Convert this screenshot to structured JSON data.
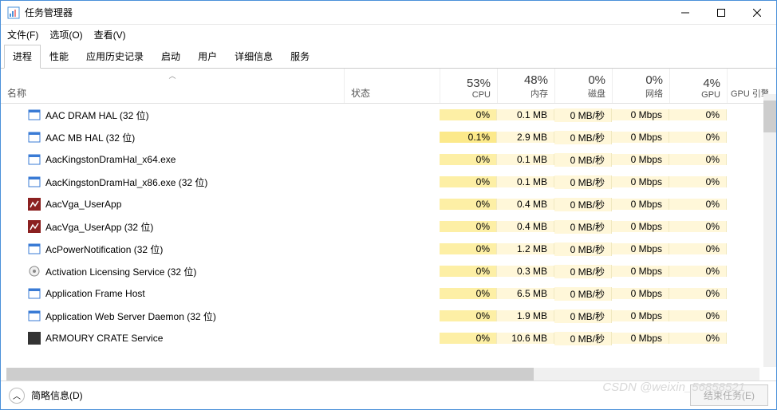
{
  "window": {
    "title": "任务管理器",
    "menus": {
      "file": "文件(F)",
      "options": "选项(O)",
      "view": "查看(V)"
    },
    "tabs": [
      "进程",
      "性能",
      "应用历史记录",
      "启动",
      "用户",
      "详细信息",
      "服务"
    ],
    "active_tab": 0
  },
  "columns": {
    "name": "名称",
    "status": "状态",
    "cpu": {
      "pct": "53%",
      "label": "CPU"
    },
    "memory": {
      "pct": "48%",
      "label": "内存"
    },
    "disk": {
      "pct": "0%",
      "label": "磁盘"
    },
    "network": {
      "pct": "0%",
      "label": "网络"
    },
    "gpu": {
      "pct": "4%",
      "label": "GPU"
    },
    "gpu_engine": "GPU 引擎"
  },
  "processes": [
    {
      "icon": "app-blue",
      "name": "AAC DRAM HAL (32 位)",
      "cpu": "0%",
      "mem": "0.1 MB",
      "disk": "0 MB/秒",
      "net": "0 Mbps",
      "gpu": "0%",
      "cpu_hl": "hl05"
    },
    {
      "icon": "app-blue",
      "name": "AAC MB HAL (32 位)",
      "cpu": "0.1%",
      "mem": "2.9 MB",
      "disk": "0 MB/秒",
      "net": "0 Mbps",
      "gpu": "0%",
      "cpu_hl": "hl1"
    },
    {
      "icon": "app-blue",
      "name": "AacKingstonDramHal_x64.exe",
      "cpu": "0%",
      "mem": "0.1 MB",
      "disk": "0 MB/秒",
      "net": "0 Mbps",
      "gpu": "0%",
      "cpu_hl": "hl05"
    },
    {
      "icon": "app-blue",
      "name": "AacKingstonDramHal_x86.exe (32 位)",
      "cpu": "0%",
      "mem": "0.1 MB",
      "disk": "0 MB/秒",
      "net": "0 Mbps",
      "gpu": "0%",
      "cpu_hl": "hl05"
    },
    {
      "icon": "app-red",
      "name": "AacVga_UserApp",
      "cpu": "0%",
      "mem": "0.4 MB",
      "disk": "0 MB/秒",
      "net": "0 Mbps",
      "gpu": "0%",
      "cpu_hl": "hl05"
    },
    {
      "icon": "app-red",
      "name": "AacVga_UserApp (32 位)",
      "cpu": "0%",
      "mem": "0.4 MB",
      "disk": "0 MB/秒",
      "net": "0 Mbps",
      "gpu": "0%",
      "cpu_hl": "hl05"
    },
    {
      "icon": "app-blue",
      "name": "AcPowerNotification (32 位)",
      "cpu": "0%",
      "mem": "1.2 MB",
      "disk": "0 MB/秒",
      "net": "0 Mbps",
      "gpu": "0%",
      "cpu_hl": "hl05"
    },
    {
      "icon": "app-gear",
      "name": "Activation Licensing Service (32 位)",
      "cpu": "0%",
      "mem": "0.3 MB",
      "disk": "0 MB/秒",
      "net": "0 Mbps",
      "gpu": "0%",
      "cpu_hl": "hl05"
    },
    {
      "icon": "app-blue",
      "name": "Application Frame Host",
      "cpu": "0%",
      "mem": "6.5 MB",
      "disk": "0 MB/秒",
      "net": "0 Mbps",
      "gpu": "0%",
      "cpu_hl": "hl05"
    },
    {
      "icon": "app-blue",
      "name": "Application Web Server Daemon (32 位)",
      "cpu": "0%",
      "mem": "1.9 MB",
      "disk": "0 MB/秒",
      "net": "0 Mbps",
      "gpu": "0%",
      "cpu_hl": "hl05"
    },
    {
      "icon": "app-dark",
      "name": "ARMOURY CRATE Service",
      "cpu": "0%",
      "mem": "10.6 MB",
      "disk": "0 MB/秒",
      "net": "0 Mbps",
      "gpu": "0%",
      "cpu_hl": "hl05"
    }
  ],
  "statusbar": {
    "fewer_details": "简略信息(D)",
    "end_task": "结束任务(E)"
  },
  "watermark": "CSDN @weixin_56858521"
}
